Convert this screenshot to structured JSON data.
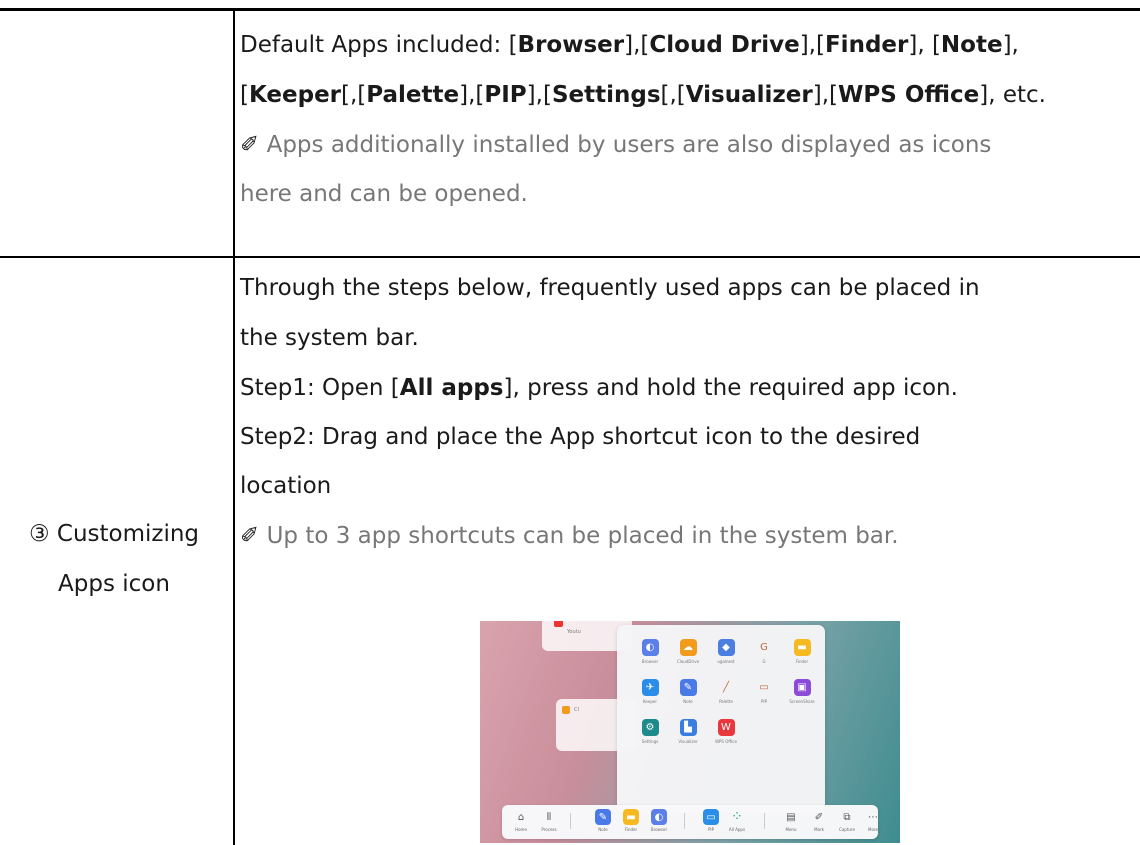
{
  "row1": {
    "line1": [
      "Default Apps included: [",
      "Browser",
      "],[",
      "Cloud Drive",
      "],[",
      "Finder",
      "], [",
      "Note",
      "],"
    ],
    "line2": [
      "[",
      "Keeper",
      "[,[",
      "Palette",
      "],[",
      "PIP",
      "],[",
      "Settings",
      "[,[",
      "Visualizer",
      "],[",
      "WPS Office",
      "], etc."
    ],
    "note_icon": "✐",
    "note1": " Apps additionally installed by users are also displayed as icons",
    "note2": "here and can be opened."
  },
  "row2": {
    "heading_line1": "③ Customizing",
    "heading_line2": "Apps icon",
    "intro1": "Through the steps below, frequently used apps can be placed in",
    "intro2": "the system bar.",
    "step1": [
      "Step1: Open [",
      "All apps",
      "], press and hold the required app icon."
    ],
    "step2_1": "Step2: Drag and place the App shortcut icon to the desired",
    "step2_2": "location",
    "note_icon": "✐",
    "note": " Up to 3 app shortcuts can be placed in the system bar."
  },
  "screenshot": {
    "bg_card_labels": [
      "Youtu",
      "Cl"
    ],
    "apps": [
      {
        "label": "Browser",
        "icon": "browser-icon",
        "color": "#5b7fe8"
      },
      {
        "label": "CloudDrive",
        "icon": "cloud-drive-icon",
        "color": "#f29b1d"
      },
      {
        "label": "ugalnest",
        "icon": "ugalnest-icon",
        "color": "#4a7fe0"
      },
      {
        "label": "G",
        "icon": "g-icon",
        "color": "#ffffff"
      },
      {
        "label": "Finder",
        "icon": "finder-icon",
        "color": "#f6b921"
      },
      {
        "label": "Keeper",
        "icon": "keeper-icon",
        "color": "#2a8ee8"
      },
      {
        "label": "Note",
        "icon": "note-icon",
        "color": "#4a7ae8"
      },
      {
        "label": "Palette",
        "icon": "palette-icon",
        "color": "#ffffff"
      },
      {
        "label": "PIP",
        "icon": "pip-icon",
        "color": "#ffffff"
      },
      {
        "label": "ScreenShare",
        "icon": "screenshare-icon",
        "color": "#8c4ad8"
      },
      {
        "label": "Settings",
        "icon": "settings-icon",
        "color": "#1e8a8c"
      },
      {
        "label": "Visualizer",
        "icon": "visualizer-icon",
        "color": "#3a7de0"
      },
      {
        "label": "WPS Office",
        "icon": "wps-office-icon",
        "color": "#e8383d"
      }
    ],
    "dock": [
      {
        "label": "Home",
        "icon": "home-icon"
      },
      {
        "label": "Process",
        "icon": "process-icon"
      },
      {
        "label": "Note",
        "icon": "note-icon"
      },
      {
        "label": "Finder",
        "icon": "finder-icon"
      },
      {
        "label": "Browser",
        "icon": "browser-icon"
      },
      {
        "label": "PIP",
        "icon": "pip-icon"
      },
      {
        "label": "All Apps",
        "icon": "all-apps-icon"
      },
      {
        "label": "Menu",
        "icon": "menu-icon"
      },
      {
        "label": "Mark",
        "icon": "mark-icon"
      },
      {
        "label": "Capture",
        "icon": "capture-icon"
      },
      {
        "label": "More",
        "icon": "more-icon"
      }
    ]
  }
}
